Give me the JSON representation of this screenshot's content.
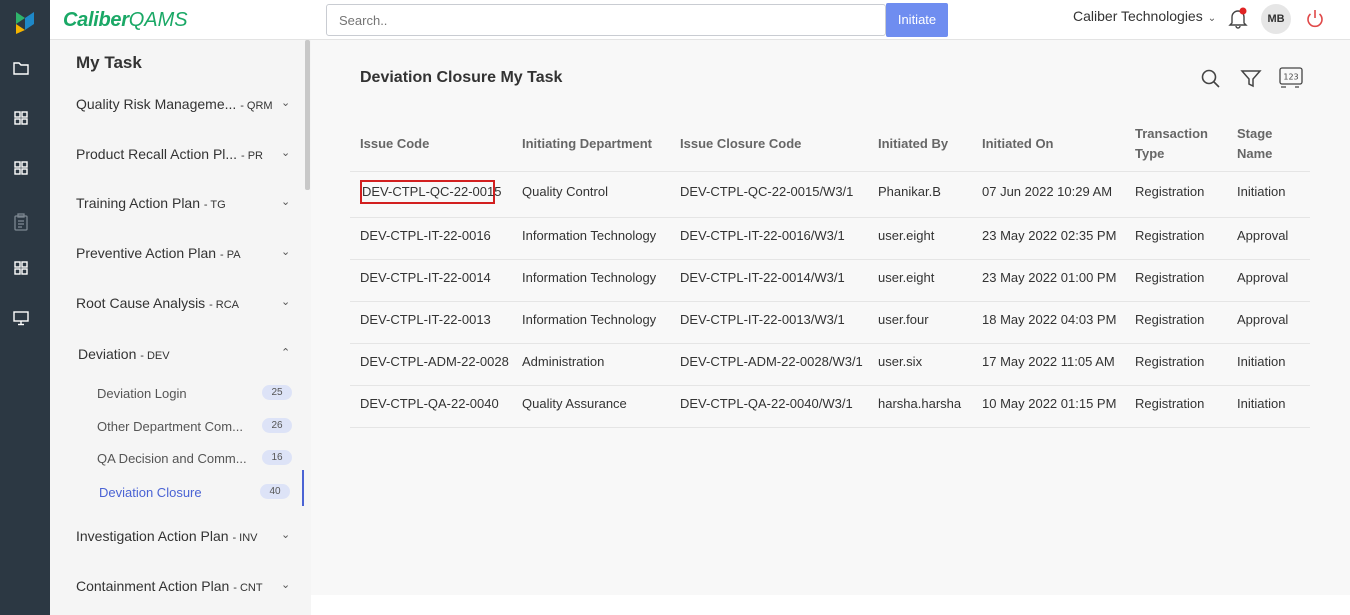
{
  "header": {
    "brand_a": "Caliber",
    "brand_b": "QAMS",
    "search_placeholder": "Search..",
    "initiate_label": "Initiate",
    "company": "Caliber Technologies",
    "avatar": "MB"
  },
  "rail": {
    "icons": [
      "logo-icon",
      "folder-icon",
      "grid-icon",
      "grid-icon",
      "clipboard-icon",
      "grid-icon",
      "monitor-icon"
    ]
  },
  "sidebar": {
    "title": "My Task",
    "items": [
      {
        "label": "Quality Risk Manageme...",
        "code": "- QRM"
      },
      {
        "label": "Product Recall Action Pl...",
        "code": "- PR"
      },
      {
        "label": "Training Action Plan",
        "code": "- TG"
      },
      {
        "label": "Preventive Action Plan",
        "code": "- PA"
      },
      {
        "label": "Root Cause Analysis",
        "code": "- RCA"
      },
      {
        "label": "Deviation",
        "code": "- DEV"
      },
      {
        "label": "Investigation Action Plan",
        "code": "- INV"
      },
      {
        "label": "Containment Action Plan",
        "code": "- CNT"
      }
    ],
    "deviation_sub": [
      {
        "label": "Deviation Login",
        "count": "25"
      },
      {
        "label": "Other Department Com...",
        "count": "26"
      },
      {
        "label": "QA Decision and Comm...",
        "count": "16"
      },
      {
        "label": "Deviation Closure",
        "count": "40"
      }
    ]
  },
  "main": {
    "title": "Deviation Closure My Task",
    "columns": [
      "Issue Code",
      "Initiating Department",
      "Issue Closure Code",
      "Initiated By",
      "Initiated On",
      "Transaction Type",
      "Stage Name"
    ],
    "rows": [
      [
        "DEV-CTPL-QC-22-0015",
        "Quality Control",
        "DEV-CTPL-QC-22-0015/W3/1",
        "Phanikar.B",
        "07 Jun 2022 10:29 AM",
        "Registration",
        "Initiation"
      ],
      [
        "DEV-CTPL-IT-22-0016",
        "Information Technology",
        "DEV-CTPL-IT-22-0016/W3/1",
        "user.eight",
        "23 May 2022 02:35 PM",
        "Registration",
        "Approval"
      ],
      [
        "DEV-CTPL-IT-22-0014",
        "Information Technology",
        "DEV-CTPL-IT-22-0014/W3/1",
        "user.eight",
        "23 May 2022 01:00 PM",
        "Registration",
        "Approval"
      ],
      [
        "DEV-CTPL-IT-22-0013",
        "Information Technology",
        "DEV-CTPL-IT-22-0013/W3/1",
        "user.four",
        "18 May 2022 04:03 PM",
        "Registration",
        "Approval"
      ],
      [
        "DEV-CTPL-ADM-22-0028",
        "Administration",
        "DEV-CTPL-ADM-22-0028/W3/1",
        "user.six",
        "17 May 2022 11:05 AM",
        "Registration",
        "Initiation"
      ],
      [
        "DEV-CTPL-QA-22-0040",
        "Quality Assurance",
        "DEV-CTPL-QA-22-0040/W3/1",
        "harsha.harsha",
        "10 May 2022 01:15 PM",
        "Registration",
        "Initiation"
      ]
    ]
  }
}
